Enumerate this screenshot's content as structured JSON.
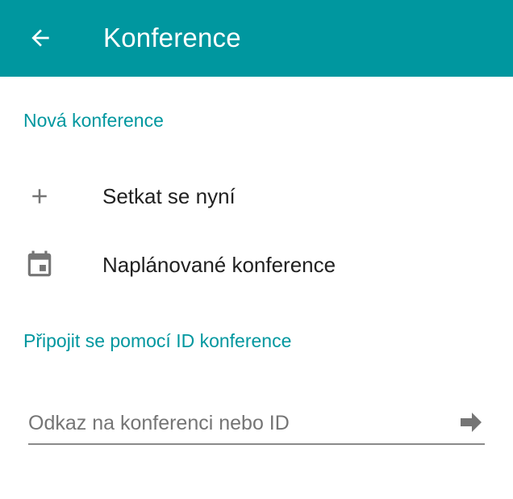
{
  "appbar": {
    "title": "Konference",
    "back_icon": "arrow-left-icon",
    "background_color": "#00979F"
  },
  "new_conference": {
    "header": "Nová konference",
    "items": [
      {
        "label": "Setkat se nyní",
        "icon": "plus-icon"
      },
      {
        "label": "Naplánované konference",
        "icon": "calendar-icon"
      }
    ]
  },
  "join": {
    "header": "Připojit se pomocí ID konference",
    "input_placeholder": "Odkaz na konferenci nebo ID",
    "input_value": "",
    "submit_icon": "arrow-right-icon"
  },
  "colors": {
    "accent": "#00979F",
    "text_primary": "#212121",
    "icon_gray": "#757575"
  }
}
